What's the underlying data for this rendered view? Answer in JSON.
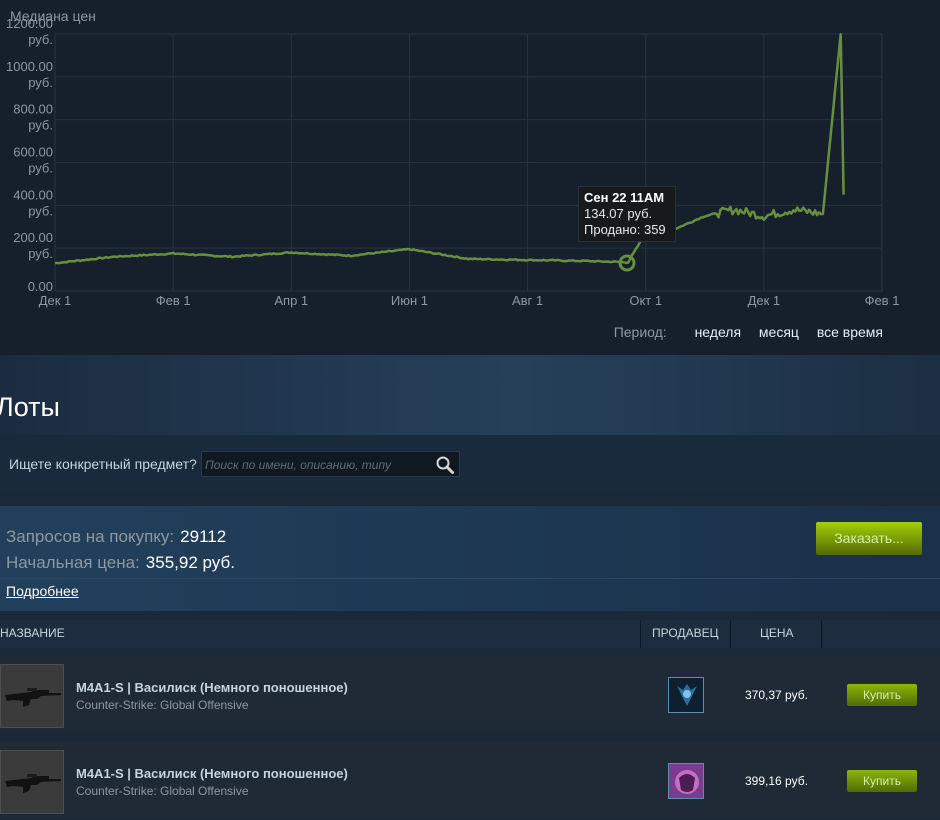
{
  "chart": {
    "title": "Медиана цен",
    "y_ticks": [
      {
        "lines": [
          "1200.00",
          "руб."
        ]
      },
      {
        "lines": [
          "1000.00",
          "руб."
        ]
      },
      {
        "lines": [
          "800.00",
          "руб."
        ]
      },
      {
        "lines": [
          "600.00",
          "руб."
        ]
      },
      {
        "lines": [
          "400.00",
          "руб."
        ]
      },
      {
        "lines": [
          "200.00",
          "руб."
        ]
      },
      {
        "lines": [
          "0.00"
        ]
      }
    ],
    "x_ticks": [
      "Дек 1",
      "Фев 1",
      "Апр 1",
      "Июн 1",
      "Авг 1",
      "Окт 1",
      "Дек 1",
      "Фев 1"
    ],
    "tooltip": {
      "date": "Сен 22 11AM",
      "price": "134.07 руб.",
      "sold": "Продано: 359"
    },
    "period_label": "Период:",
    "period_options": [
      "неделя",
      "месяц",
      "все время"
    ],
    "line_color": "#688f3e"
  },
  "chart_data": {
    "type": "line",
    "title": "Медиана цен",
    "xlabel": "",
    "ylabel": "",
    "ylim": [
      0,
      1200
    ],
    "x_range": [
      "Дек 1",
      "Фев 1"
    ],
    "grid": true,
    "series": [
      {
        "values_by_month": [
          {
            "x": "Дек 1",
            "y": 130
          },
          {
            "x": "Янв 1",
            "y": 160
          },
          {
            "x": "Фев 1",
            "y": 175
          },
          {
            "x": "Мар 1",
            "y": 160
          },
          {
            "x": "Апр 1",
            "y": 180
          },
          {
            "x": "Май 1",
            "y": 165
          },
          {
            "x": "Июн 1",
            "y": 195
          },
          {
            "x": "Июл 1",
            "y": 150
          },
          {
            "x": "Авг 1",
            "y": 145
          },
          {
            "x": "Сен 1",
            "y": 140
          },
          {
            "x": "Сен 22",
            "y": 134.07
          },
          {
            "x": "Окт 1",
            "y": 270
          },
          {
            "x": "Окт 15",
            "y": 290
          },
          {
            "x": "Ноя 1",
            "y": 350
          },
          {
            "x": "Ноя 15",
            "y": 380
          },
          {
            "x": "Дек 1",
            "y": 350
          },
          {
            "x": "Дек 15",
            "y": 380
          },
          {
            "x": "Янв 1",
            "y": 360
          },
          {
            "x": "Янв 10",
            "y": 1200
          },
          {
            "x": "Янв 12",
            "y": 450
          }
        ]
      }
    ]
  },
  "lots": {
    "title": "Лоты",
    "search_label": "Ищете конкретный предмет?",
    "search_placeholder": "Поиск по имени, описанию, типу",
    "requests_label": "Запросов на покупку:",
    "requests_value": "29112",
    "start_price_label": "Начальная цена:",
    "start_price_value": "355,92 руб.",
    "details_link": "Подробнее",
    "order_button": "Заказать...",
    "columns": {
      "name": "НАЗВАНИЕ",
      "seller": "ПРОДАВЕЦ",
      "price": "ЦЕНА"
    },
    "rows": [
      {
        "name": "M4A1-S | Василиск (Немного поношенное)",
        "game": "Counter-Strike: Global Offensive",
        "price": "370,37 руб.",
        "buy": "Купить"
      },
      {
        "name": "M4A1-S | Василиск (Немного поношенное)",
        "game": "Counter-Strike: Global Offensive",
        "price": "399,16 руб.",
        "buy": "Купить"
      }
    ]
  },
  "colors": {
    "accent_green": "#a4d007",
    "background": "#1b2838"
  }
}
